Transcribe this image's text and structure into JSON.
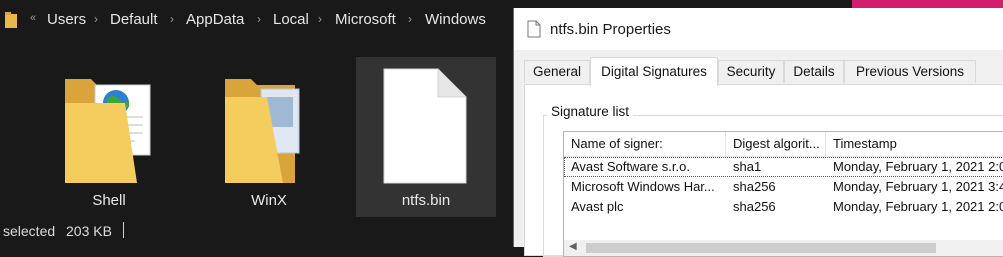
{
  "explorer": {
    "breadcrumb": [
      "Users",
      "Default",
      "AppData",
      "Local",
      "Microsoft",
      "Windows"
    ],
    "items": [
      {
        "label": "Shell",
        "icon": "folder-with-web-document-icon"
      },
      {
        "label": "WinX",
        "icon": "folder-icon"
      },
      {
        "label": "ntfs.bin",
        "icon": "blank-file-icon",
        "selected": true
      }
    ],
    "status": {
      "selected_text": "selected",
      "size": "203 KB"
    }
  },
  "dialog": {
    "title": "ntfs.bin Properties",
    "tabs": [
      "General",
      "Digital Signatures",
      "Security",
      "Details",
      "Previous Versions"
    ],
    "active_tab": "Digital Signatures",
    "group_label": "Signature list",
    "columns": [
      "Name of signer:",
      "Digest algorit...",
      "Timestamp"
    ],
    "rows": [
      {
        "name": "Avast Software s.r.o.",
        "digest": "sha1",
        "timestamp": "Monday, February 1, 2021 2:0"
      },
      {
        "name": "Microsoft Windows Har...",
        "digest": "sha256",
        "timestamp": "Monday, February 1, 2021 3:4"
      },
      {
        "name": "Avast plc",
        "digest": "sha256",
        "timestamp": "Monday, February 1, 2021 2:0"
      }
    ]
  },
  "colors": {
    "accent_pink": "#d11f6b",
    "explorer_bg": "#191919",
    "selected_item_bg": "#333333"
  }
}
